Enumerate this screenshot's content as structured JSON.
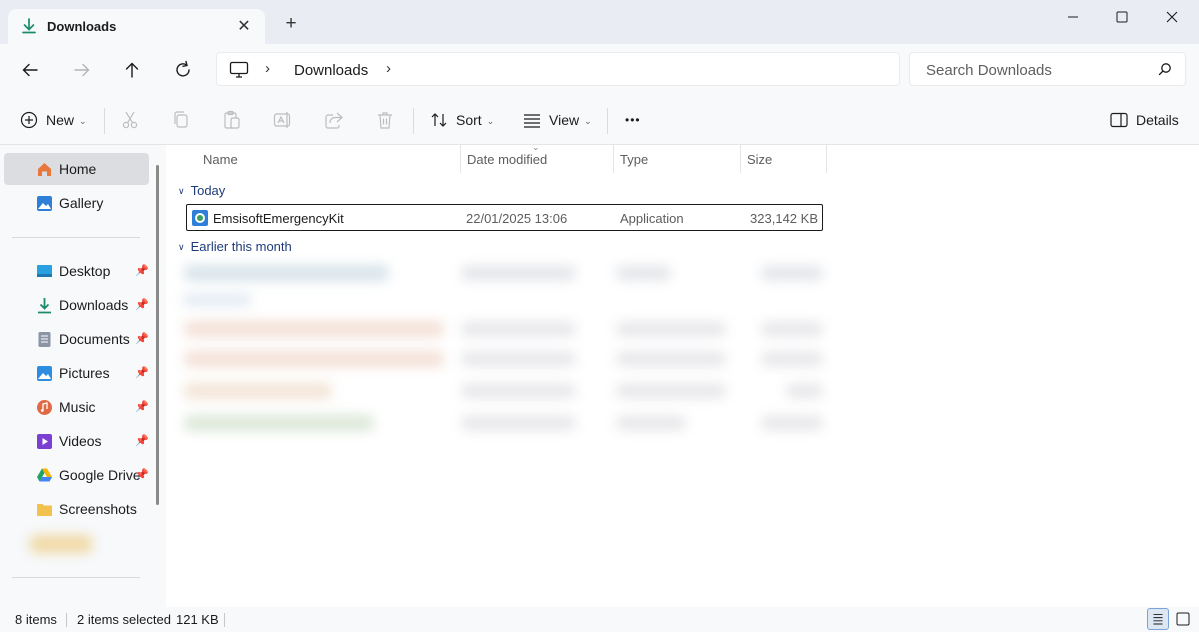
{
  "tab": {
    "title": "Downloads",
    "close": "✕",
    "new_tab": "+"
  },
  "window": {
    "min": "minimize",
    "max": "maximize",
    "close": "close"
  },
  "address": {
    "crumbs": [
      "Downloads"
    ],
    "sep": "›"
  },
  "search": {
    "placeholder": "Search Downloads"
  },
  "commands": {
    "new": "New",
    "sort": "Sort",
    "view": "View",
    "more": "•••",
    "details": "Details"
  },
  "sidebar": {
    "items": [
      {
        "label": "Home",
        "icon": "home-icon",
        "color": "#e8773b"
      },
      {
        "label": "Gallery",
        "icon": "gallery-icon",
        "color": "#2f7fd8"
      },
      {
        "label": "Desktop",
        "icon": "desktop-icon",
        "color": "#2aa0e0",
        "pinned": true
      },
      {
        "label": "Downloads",
        "icon": "downloads-icon",
        "color": "#1a8a6a",
        "pinned": true
      },
      {
        "label": "Documents",
        "icon": "documents-icon",
        "color": "#8b95a5",
        "pinned": true
      },
      {
        "label": "Pictures",
        "icon": "pictures-icon",
        "color": "#2f8de0",
        "pinned": true
      },
      {
        "label": "Music",
        "icon": "music-icon",
        "color": "#e06a45",
        "pinned": true
      },
      {
        "label": "Videos",
        "icon": "videos-icon",
        "color": "#7b3fd1",
        "pinned": true
      },
      {
        "label": "Google Drive",
        "icon": "google-drive-icon",
        "color": "#1fa463",
        "pinned": true
      },
      {
        "label": "Screenshots",
        "icon": "folder-icon",
        "color": "#f2c14e"
      }
    ],
    "pin_glyph": "📌"
  },
  "columns": {
    "name": "Name",
    "date": "Date modified",
    "type": "Type",
    "size": "Size"
  },
  "groups": {
    "today": "Today",
    "earlier": "Earlier this month"
  },
  "files": {
    "selected": {
      "name": "EmsisoftEmergencyKit",
      "date": "22/01/2025 13:06",
      "type": "Application",
      "size": "323,142 KB"
    }
  },
  "status": {
    "items": "8 items",
    "selected": "2 items selected",
    "size": "121 KB"
  }
}
